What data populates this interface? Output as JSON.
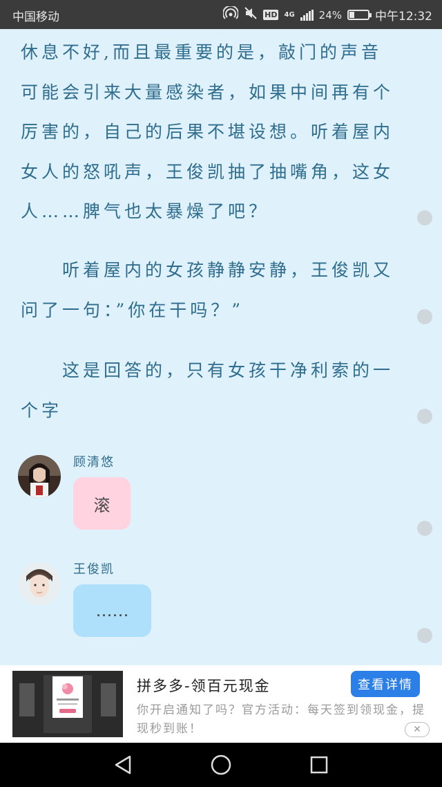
{
  "status_bar": {
    "carrier": "中国移动",
    "network": "4G",
    "hd": "HD",
    "battery_text": "24%",
    "battery_level": 0.24,
    "time": "中午12:32",
    "icons": [
      "hotspot-icon",
      "mute-icon",
      "hd-icon",
      "signal-icon",
      "battery-icon"
    ]
  },
  "story": {
    "paragraphs": [
      "休息不好,而且最重要的是，敲门的声音可能会引来大量感染者，如果中间再有个厉害的，自己的后果不堪设想。听着屋内女人的怒吼声，王俊凯抽了抽嘴角，这女人……脾气也太暴燥了吧？",
      "听着屋内的女孩静静安静，王俊凯又问了一句：”你在干吗？”",
      "这是回答的，只有女孩干净利索的一个字"
    ]
  },
  "chat": [
    {
      "name": "顾清悠",
      "message": "滚",
      "bubble_color": "#ffd3df"
    },
    {
      "name": "王俊凯",
      "message": "……",
      "bubble_color": "#aee0fb"
    }
  ],
  "ad": {
    "title": "拼多多-领百元现金",
    "button": "查看详情",
    "description": "你开启通知了吗？官方活动：每天签到领现金，提现秒到账！",
    "close": "✕"
  },
  "nav": {
    "icons": [
      "back-triangle-icon",
      "home-circle-icon",
      "recents-square-icon"
    ]
  },
  "colors": {
    "background": "#dff1fb",
    "text": "#2f6d8e",
    "status_bar": "#3b3b3b",
    "ad_button": "#2b7fe6"
  }
}
